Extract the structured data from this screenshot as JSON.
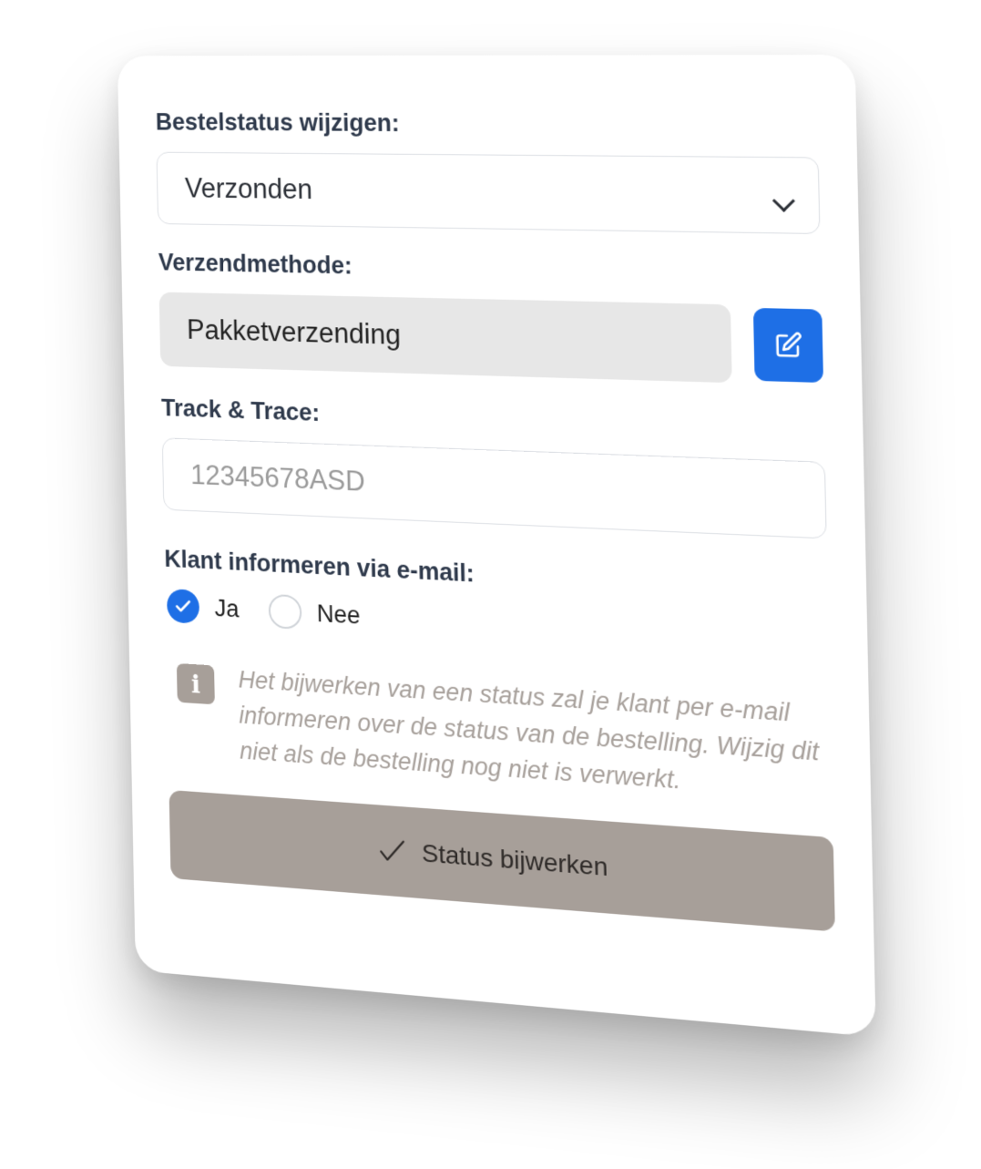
{
  "status": {
    "label": "Bestelstatus wijzigen:",
    "selected": "Verzonden"
  },
  "shipping": {
    "label": "Verzendmethode:",
    "value": "Pakketverzending"
  },
  "tracking": {
    "label": "Track & Trace:",
    "placeholder": "12345678ASD"
  },
  "notify": {
    "label": "Klant informeren via e-mail:",
    "options": [
      {
        "label": "Ja",
        "checked": true
      },
      {
        "label": "Nee",
        "checked": false
      }
    ]
  },
  "info": {
    "text": "Het bijwerken van een status zal je klant per e-mail informeren over de status van de bestelling. Wijzig dit niet als de bestelling nog niet is verwerkt."
  },
  "submit": {
    "label": "Status bijwerken"
  },
  "colors": {
    "accent": "#1e6fe6",
    "muted_button": "#a79f99",
    "label_text": "#2f3a4c"
  }
}
